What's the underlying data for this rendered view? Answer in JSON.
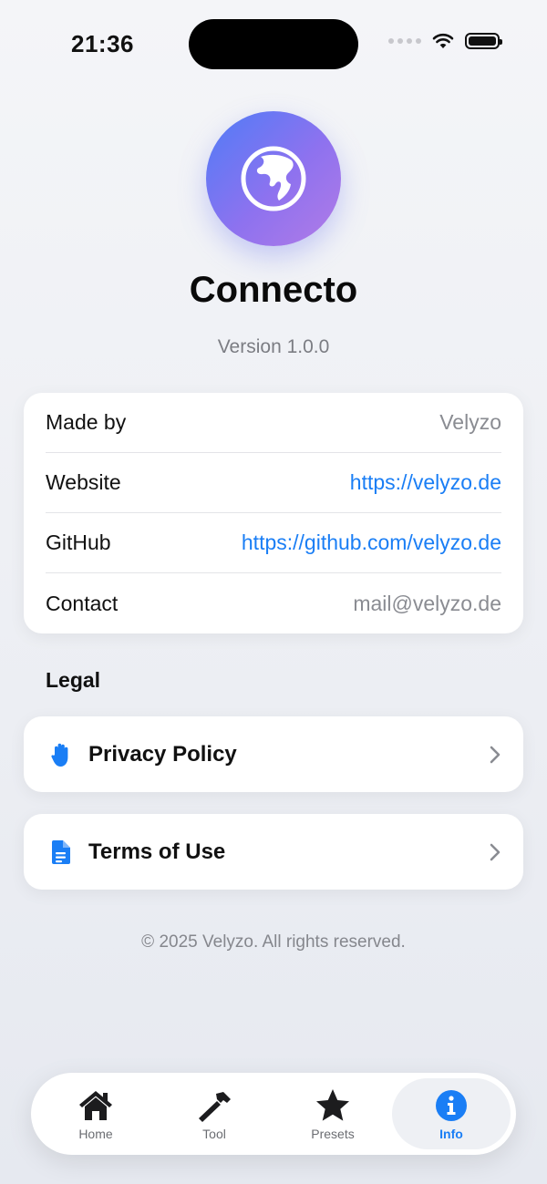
{
  "status_bar": {
    "time": "21:36"
  },
  "app": {
    "name": "Connecto",
    "version": "Version 1.0.0",
    "icon": "globe-icon"
  },
  "info": [
    {
      "label": "Made by",
      "value": "Velyzo",
      "link": false
    },
    {
      "label": "Website",
      "value": "https://velyzo.de",
      "link": true
    },
    {
      "label": "GitHub",
      "value": "https://github.com/velyzo.de",
      "link": true
    },
    {
      "label": "Contact",
      "value": "mail@velyzo.de",
      "link": false
    }
  ],
  "legal": {
    "title": "Legal",
    "items": [
      {
        "label": "Privacy Policy",
        "icon": "hand-icon"
      },
      {
        "label": "Terms of Use",
        "icon": "document-icon"
      }
    ]
  },
  "footer": {
    "copyright": "© 2025 Velyzo. All rights reserved."
  },
  "tabs": [
    {
      "label": "Home",
      "icon": "house-icon",
      "active": false
    },
    {
      "label": "Tool",
      "icon": "hammer-icon",
      "active": false
    },
    {
      "label": "Presets",
      "icon": "star-icon",
      "active": false
    },
    {
      "label": "Info",
      "icon": "info-icon",
      "active": true
    }
  ],
  "colors": {
    "accent": "#1a7ef5",
    "secondary_text": "#8a8c92",
    "gradient_start": "#4f7cf7",
    "gradient_end": "#b27be6"
  }
}
